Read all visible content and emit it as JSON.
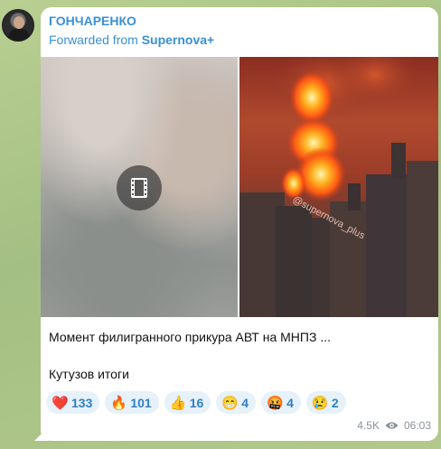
{
  "message": {
    "sender": "ГОНЧАРЕНКО",
    "forwarded_prefix": "Forwarded from ",
    "forwarded_source": "Supernova+",
    "watermark": "@supernova_plus",
    "caption_line1": "Момент филигранного прикура АВТ на МНПЗ ...",
    "caption_line2": "Кутузов итоги",
    "views": "4.5K",
    "time": "06:03"
  },
  "reactions": [
    {
      "emoji": "❤️",
      "icon": "heart-icon",
      "count": "133"
    },
    {
      "emoji": "🔥",
      "icon": "fire-icon",
      "count": "101"
    },
    {
      "emoji": "👍",
      "icon": "thumbs-up-icon",
      "count": "16"
    },
    {
      "emoji": "😁",
      "icon": "grinning-face-icon",
      "count": "4"
    },
    {
      "emoji": "🤬",
      "icon": "angry-face-icon",
      "count": "4"
    },
    {
      "emoji": "😢",
      "icon": "crying-face-icon",
      "count": "2"
    }
  ],
  "colors": {
    "accent": "#3a8fd6",
    "reaction_bg": "#e6f1fa",
    "bubble": "#ffffff",
    "wallpaper": "#a9c38a"
  }
}
